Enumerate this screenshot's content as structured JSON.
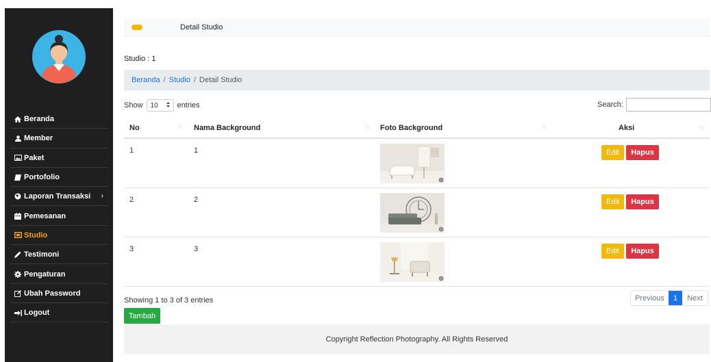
{
  "sidebar": {
    "items": [
      {
        "label": "Beranda",
        "icon": "home-icon"
      },
      {
        "label": "Member",
        "icon": "user-icon"
      },
      {
        "label": "Paket",
        "icon": "image-icon"
      },
      {
        "label": "Portofolio",
        "icon": "book-icon"
      },
      {
        "label": "Laporan Transaksi",
        "icon": "globe-icon",
        "chevron": "›"
      },
      {
        "label": "Pemesanan",
        "icon": "calendar-icon"
      },
      {
        "label": "Studio",
        "icon": "studio-icon",
        "active": true
      },
      {
        "label": "Testimoni",
        "icon": "pencil-icon"
      },
      {
        "label": "Pengaturan",
        "icon": "gear-icon"
      },
      {
        "label": "Ubah Password",
        "icon": "edit-icon"
      },
      {
        "label": "Logout",
        "icon": "logout-icon"
      }
    ]
  },
  "header": {
    "title": "Detail Studio"
  },
  "studio_label": "Studio : 1",
  "breadcrumb": {
    "home": "Beranda",
    "sep": "/",
    "studio": "Studio",
    "current": "Detail Studio"
  },
  "table_controls": {
    "show_label": "Show",
    "entries_value": "10",
    "entries_label": "entries",
    "search_label": "Search:",
    "search_value": ""
  },
  "table": {
    "columns": [
      "No",
      "Nama Background",
      "Foto Background",
      "Aksi"
    ],
    "rows": [
      {
        "no": "1",
        "nama": "1",
        "foto": "white-sofa-room-photo"
      },
      {
        "no": "2",
        "nama": "2",
        "foto": "grey-sofa-clock-photo"
      },
      {
        "no": "3",
        "nama": "3",
        "foto": "armchair-lamp-photo"
      }
    ],
    "edit_label": "Edit",
    "hapus_label": "Hapus"
  },
  "info": "Showing 1 to 3 of 3 entries",
  "pagination": {
    "previous": "Previous",
    "current": "1",
    "next": "Next"
  },
  "tambah_label": "Tambah",
  "footer": "Copyright Reflection Photography. All Rights Reserved",
  "colors": {
    "sidebar": "#1f1f1f",
    "accent": "#f0a30a",
    "edit": "#f0b90b",
    "hapus": "#dc3545",
    "tambah": "#28a745",
    "link": "#1a73e8"
  }
}
